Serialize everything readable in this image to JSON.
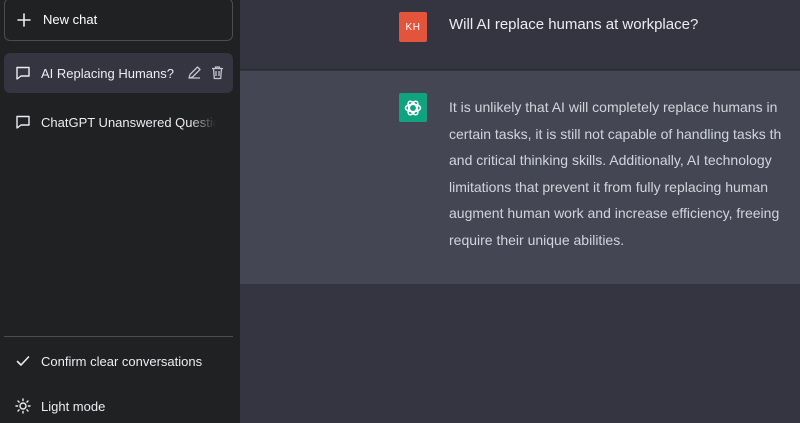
{
  "sidebar": {
    "new_chat_label": "New chat",
    "conversations": [
      {
        "label": "AI Replacing Humans?",
        "active": true
      },
      {
        "label": "ChatGPT Unanswered Questio",
        "active": false
      }
    ],
    "confirm_clear_label": "Confirm clear conversations",
    "light_mode_label": "Light mode"
  },
  "thread": {
    "user": {
      "avatar_initials": "KH",
      "avatar_color": "#e2543c",
      "message": "Will AI replace humans at workplace?"
    },
    "assistant": {
      "avatar_icon": "openai-logo-icon",
      "avatar_color": "#10a37f",
      "lines": [
        "It is unlikely that AI will completely replace humans in",
        "certain tasks, it is still not capable of handling tasks th",
        "and critical thinking skills. Additionally, AI technology",
        "limitations that prevent it from fully replacing human",
        "augment human work and increase efficiency, freeing",
        "require their unique abilities."
      ]
    }
  },
  "colors": {
    "sidebar_bg": "#202123",
    "main_bg": "#343541",
    "assistant_bg": "#444654"
  }
}
